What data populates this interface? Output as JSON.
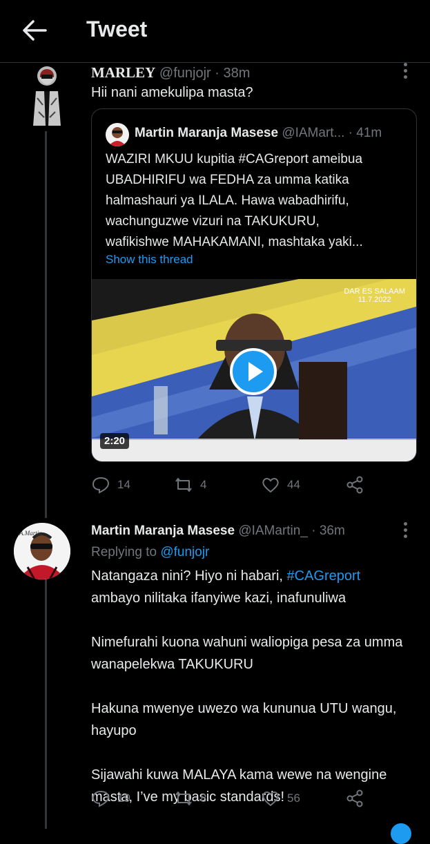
{
  "header": {
    "title": "Tweet"
  },
  "tweet1": {
    "display_name": "MARLEY",
    "handle": "@funjojr",
    "separator": "·",
    "time": "38m",
    "text": "Hii nani amekulipa masta?",
    "quote": {
      "display_name": "Martin Maranja Masese",
      "handle": "@IAMart...",
      "separator": "·",
      "time": "41m",
      "lines": [
        "WAZIRI MKUU kupitia #CAGreport ameibua",
        "UBADHIRIFU wa FEDHA za umma katika",
        "halmashauri ya ILALA. Hawa wabadhirifu,",
        "wachunguzwe vizuri na TAKUKURU,",
        "wafikishwe MAHAKAMANI, mashtaka yaki..."
      ],
      "show_thread": "Show this thread",
      "video": {
        "location": "DAR ES SALAAM",
        "date": "11.7.2022",
        "duration": "2:20"
      }
    },
    "stats": {
      "replies": "14",
      "retweets": "4",
      "likes": "44"
    }
  },
  "tweet2": {
    "display_name": "Martin Maranja Masese",
    "handle": "@IAMartin_",
    "separator": "·",
    "time": "36m",
    "replying_to_label": "Replying to",
    "replying_to_handle": "@funjojr",
    "avatar_text": "A.Martin",
    "para1_a": "Natangaza nini? Hiyo ni habari,",
    "para1_hashtag": "#CAGreport",
    "para1_b": "ambayo nilitaka ifanyiwe kazi, inafunuliwa",
    "para2_line1": "Nimefurahi kuona wahuni waliopiga pesa za umma",
    "para2_line2": "wanapelekwa TAKUKURU",
    "para3_line1": "Hakuna mwenye uwezo wa kununua UTU wangu,",
    "para3_line2": "hayupo",
    "para4_line1": "Sijawahi kuwa MALAYA kama wewe na wengine",
    "para4_line2": "masta, I’ve my basic standards!",
    "stats": {
      "replies": "19",
      "retweets": "8",
      "likes": "56"
    }
  },
  "colors": {
    "background": "#000000",
    "text": "#e7e9ea",
    "muted": "#71767b",
    "link": "#1d9bf0",
    "border": "#2f3336"
  }
}
